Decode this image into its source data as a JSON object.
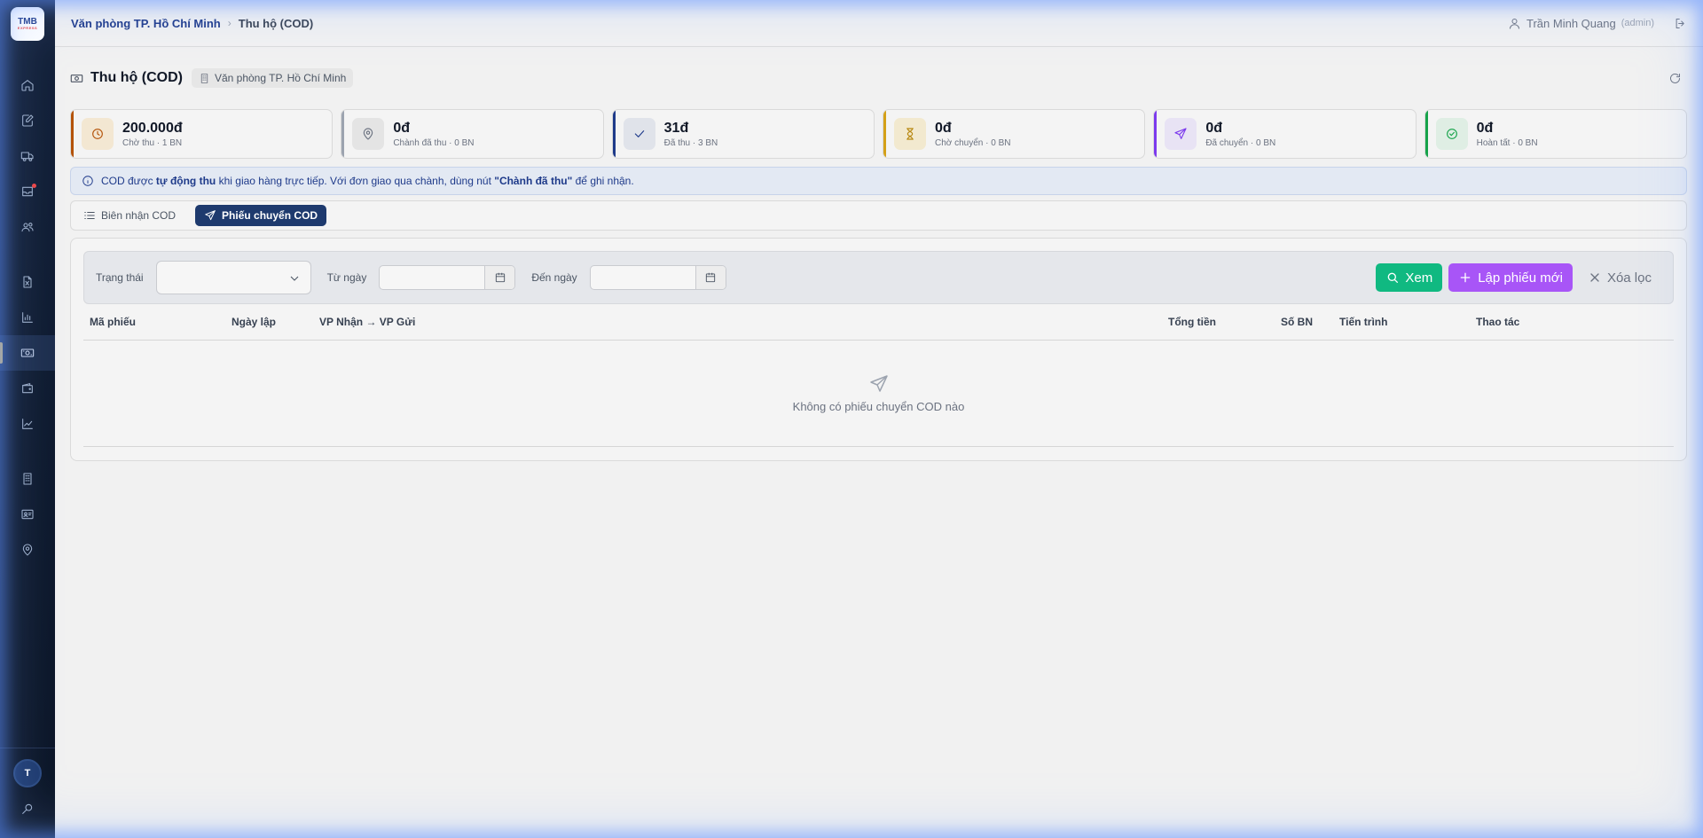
{
  "app": {
    "logo_text": "TMB",
    "logo_sub": "EXPRESS"
  },
  "sidebar": {
    "items": [
      {
        "icon": "home-icon"
      },
      {
        "icon": "edit-document-icon"
      },
      {
        "icon": "truck-icon"
      },
      {
        "icon": "inbox-icon"
      },
      {
        "icon": "users-icon"
      },
      {
        "icon": "spreadsheet-icon"
      },
      {
        "icon": "bar-chart-icon"
      },
      {
        "icon": "banknote-icon"
      },
      {
        "icon": "wallet-icon"
      },
      {
        "icon": "trend-chart-icon"
      },
      {
        "icon": "building-icon"
      },
      {
        "icon": "id-card-icon"
      },
      {
        "icon": "map-pin-icon"
      }
    ],
    "avatar_initial": "T"
  },
  "breadcrumb": {
    "office": "Văn phòng TP. Hồ Chí Minh",
    "current": "Thu hộ (COD)"
  },
  "user": {
    "name": "Trần Minh Quang",
    "role": "(admin)"
  },
  "page": {
    "title": "Thu hộ (COD)",
    "office_chip": "Văn phòng TP. Hồ Chí Minh"
  },
  "stats": [
    {
      "value": "200.000đ",
      "label": "Chờ thu · 1 BN",
      "color": "#b45309"
    },
    {
      "value": "0đ",
      "label": "Chành đã thu · 0 BN",
      "color": "#9ca3af"
    },
    {
      "value": "31đ",
      "label": "Đã thu · 3 BN",
      "color": "#1e3a8a"
    },
    {
      "value": "0đ",
      "label": "Chờ chuyển · 0 BN",
      "color": "#d4a017"
    },
    {
      "value": "0đ",
      "label": "Đã chuyển · 0 BN",
      "color": "#7c3aed"
    },
    {
      "value": "0đ",
      "label": "Hoàn tất · 0 BN",
      "color": "#16a34a"
    }
  ],
  "info": {
    "prefix": "COD được ",
    "bold1": "tự động thu",
    "middle": " khi giao hàng trực tiếp. Với đơn giao qua chành, dùng nút ",
    "bold2": "\"Chành đã thu\"",
    "suffix": " để ghi nhận."
  },
  "tabs": [
    {
      "label": "Biên nhận COD",
      "active": false
    },
    {
      "label": "Phiếu chuyển COD",
      "active": true
    }
  ],
  "filters": {
    "status_label": "Trạng thái",
    "status_value": "",
    "from_label": "Từ ngày",
    "from_value": "",
    "to_label": "Đến ngày",
    "to_value": "",
    "view_button": "Xem",
    "new_button": "Lập phiếu mới",
    "clear_button": "Xóa lọc"
  },
  "table": {
    "columns": [
      "Mã phiếu",
      "Ngày lập",
      "VP Nhận → VP Gửi",
      "Tổng tiền",
      "Số BN",
      "Tiến trình",
      "Thao tác"
    ],
    "empty_text": "Không có phiếu chuyển COD nào"
  },
  "colors": {
    "accent": "#1e3a6e",
    "view": "#10b981",
    "new": "#a855f7"
  }
}
